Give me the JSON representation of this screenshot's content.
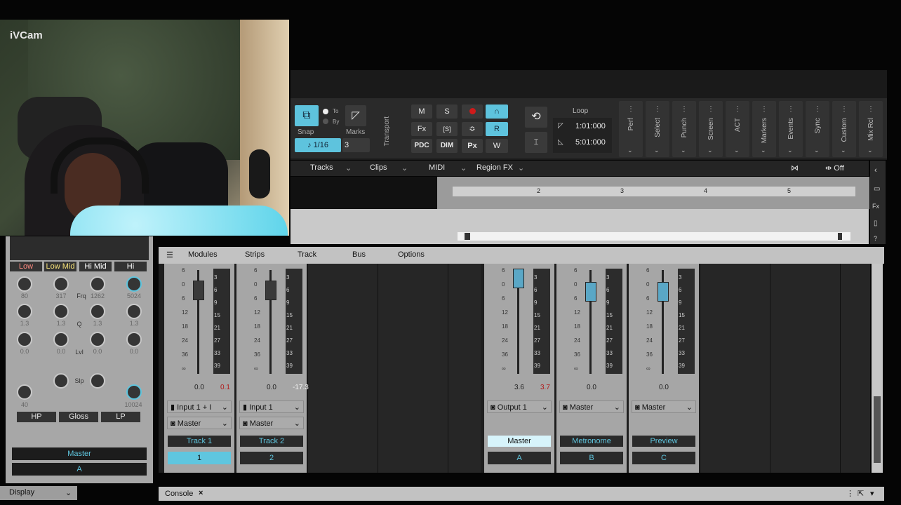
{
  "webcam": {
    "label": "iVCam"
  },
  "control_bar": {
    "snap_label": "Snap",
    "snap_value": "1/16",
    "to_label": "To",
    "by_label": "By",
    "marks_label": "Marks",
    "marks_value": "3",
    "transport_label": "Transport",
    "btn_m": "M",
    "btn_s": "S",
    "btn_fx": "Fx",
    "btn_bracket_s": "[S]",
    "btn_r": "R",
    "btn_pdc": "PDC",
    "btn_dim": "DIM",
    "btn_px": "Px",
    "btn_w": "W",
    "loop_label": "Loop",
    "loop_start": "1:01:000",
    "loop_end": "5:01:000",
    "sections": [
      "Perf",
      "Select",
      "Punch",
      "Screen",
      "ACT",
      "Markers",
      "Events",
      "Sync",
      "Custom",
      "Mix Rcl"
    ]
  },
  "track_menu": {
    "items": [
      "Tracks",
      "Clips",
      "MIDI",
      "Region FX"
    ],
    "off_label": "Off"
  },
  "timeline": {
    "ruler_marks": [
      "2",
      "3",
      "4",
      "5"
    ]
  },
  "prochannel": {
    "bands": [
      "Low",
      "Low Mid",
      "Hi Mid",
      "Hi"
    ],
    "freq_values": [
      "80",
      "317",
      "1262",
      "5024"
    ],
    "freq_label": "Frq",
    "q_values": [
      "1.3",
      "1.3",
      "1.3",
      "1.3"
    ],
    "q_label": "Q",
    "lvl_values": [
      "0.0",
      "0.0",
      "0.0",
      "0.0"
    ],
    "lvl_label": "Lvl",
    "slp_label": "Slp",
    "hp_value": "40",
    "lp_value": "10024",
    "hp_button": "HP",
    "gloss_button": "Gloss",
    "lp_button": "LP",
    "output": "Master",
    "strip_letter": "A",
    "display_label": "Display"
  },
  "console": {
    "menu": [
      "Modules",
      "Strips",
      "Track",
      "Bus",
      "Options"
    ],
    "tab_label": "Console",
    "scale_labels": [
      "6",
      "0",
      "6",
      "12",
      "18",
      "24",
      "36",
      "∞"
    ],
    "meter_labels": [
      "3",
      "6",
      "9",
      "15",
      "21",
      "27",
      "33",
      "39"
    ],
    "strips": [
      {
        "fader": "0.0",
        "peak": "0.1",
        "input": "Input 1 + I",
        "output": "Master",
        "name": "Track 1",
        "number": "1"
      },
      {
        "fader": "0.0",
        "peak": "-17.3",
        "input": "Input 1",
        "output": "Master",
        "name": "Track 2",
        "number": "2"
      },
      {
        "fader": "3.6",
        "peak": "3.7",
        "output": "Output 1",
        "name": "Master",
        "letter": "A"
      },
      {
        "fader": "0.0",
        "output": "Master",
        "name": "Metronome",
        "letter": "B"
      },
      {
        "fader": "0.0",
        "output": "Master",
        "name": "Preview",
        "letter": "C"
      }
    ]
  },
  "colors": {
    "accent": "#5fc6df",
    "record": "#d01a1a",
    "band_label": "#ff8a80",
    "band_label_mid": "#f6e27a"
  }
}
